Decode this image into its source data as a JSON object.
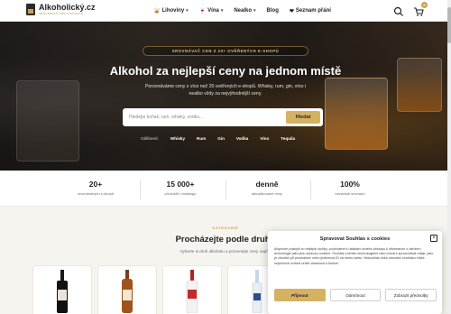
{
  "header": {
    "logo_text": "Alkoholický.cz",
    "logo_tagline": "SROVNÁVAČ CEN ALKOHOLU",
    "nav": [
      {
        "emoji": "🥃",
        "label": "Lihoviny",
        "has_dropdown": true
      },
      {
        "emoji": "🍷",
        "label": "Vína",
        "has_dropdown": true
      },
      {
        "emoji": "",
        "label": "Nealko",
        "has_dropdown": true
      },
      {
        "emoji": "",
        "label": "Blog",
        "has_dropdown": false
      },
      {
        "emoji": "❤",
        "label": "Seznam přání",
        "has_dropdown": false
      }
    ],
    "cart_count": "0",
    "icons": [
      "search-icon",
      "cart-icon"
    ]
  },
  "hero": {
    "eyebrow": "SROVNÁVAČ CEN Z 20+ OVĚŘENÝCH E-SHOPŮ",
    "title": "Alkohol za nejlepší ceny na jednom místě",
    "subtitle_line1": "Porovnáváme ceny z více než 20 ověřených e-shopů. Whisky, rum, gin, víno i",
    "subtitle_line2": "nealko vždy za nejvýhodnější ceny.",
    "search_placeholder": "Hledejte koňak, rum, whisky, vodku...",
    "search_button": "Hledat",
    "popular_label": "Oblíbené:",
    "popular": [
      "Whisky",
      "Rum",
      "Gin",
      "Vodka",
      "Víno",
      "Tequila"
    ]
  },
  "stats": [
    {
      "value": "20+",
      "label": "srovnávaných e-shopů"
    },
    {
      "value": "15 000+",
      "label": "produktů v katalogu"
    },
    {
      "value": "denně",
      "label": "aktualizované ceny"
    },
    {
      "value": "100%",
      "label": "nezávislé srovnání"
    }
  ],
  "categories": {
    "eyebrow": "KATEGORIE",
    "title": "Procházejte podle druhu",
    "subtitle": "Vyberte si druh alkoholu a porovnejte ceny napříč"
  },
  "cookie": {
    "title": "Spravovat Souhlas s cookies",
    "text": "Abychom poskytli co nejlepší služby, používáme k ukládání a/nebo přístupu k informacím o zařízení, technologie jako jsou soubory cookies. Souhlas s těmito technologiemi nám umožní zpracovávat údaje, jako je chování při procházení nebo jedinečná ID na tomto webu. Nesouhlas nebo odvolání souhlasu může nepříznivě ovlivnit určité vlastnosti a funkce.",
    "accept": "Přijmout",
    "deny": "Odmítnout",
    "preferences": "Zobrazit předvolby"
  },
  "colors": {
    "accent": "#d6b162",
    "gold_text": "#c9a24a",
    "dark": "#1f1f1f",
    "page_bg": "#f6f4ef"
  }
}
